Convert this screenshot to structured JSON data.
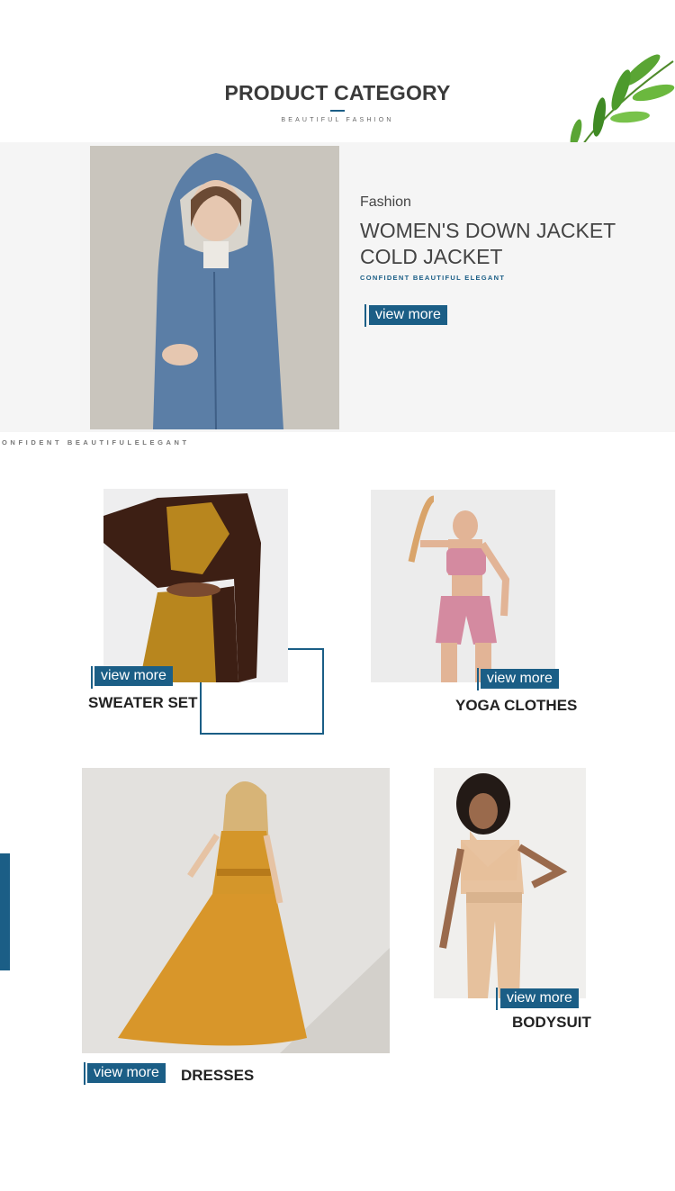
{
  "header": {
    "title": "PRODUCT CATEGORY",
    "subtitle": "BEAUTIFUL FASHION"
  },
  "hero": {
    "eyebrow": "Fashion",
    "headline_line1": "WOMEN'S DOWN JACKET",
    "headline_line2": "COLD JACKET",
    "tagline": "CONFIDENT BEAUTIFUL ELEGANT",
    "cta": "view more"
  },
  "strip_text": "ONFIDENT BEAUTIFULELEGANT",
  "categories": [
    {
      "label": "SWEATER SET",
      "cta": "view more"
    },
    {
      "label": "YOGA CLOTHES",
      "cta": "view more"
    },
    {
      "label": "DRESSES",
      "cta": "view more"
    },
    {
      "label": "BODYSUIT",
      "cta": "view more"
    }
  ],
  "colors": {
    "accent": "#1b5e86",
    "hero_background": "#f5f5f5"
  },
  "icons": [
    "leaf-decoration-icon"
  ]
}
